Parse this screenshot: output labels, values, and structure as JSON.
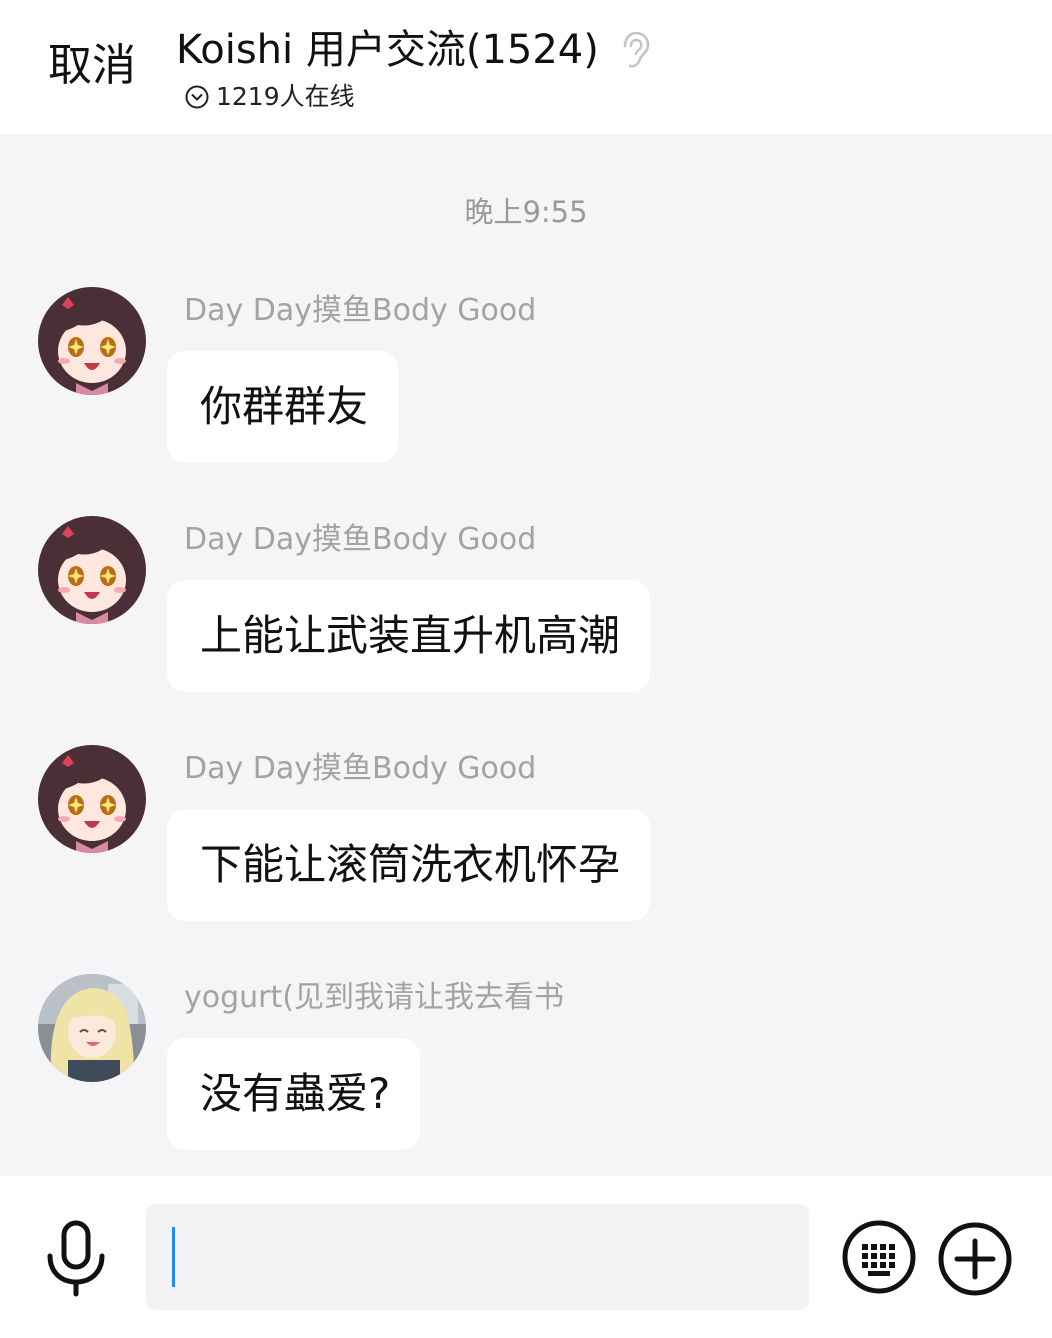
{
  "header": {
    "cancel_label": "取消",
    "title": "Koishi 用户交流(1524)",
    "online_text": "1219人在线"
  },
  "timestamp": "晚上9:55",
  "messages": [
    {
      "sender": "Day Day摸鱼Body Good",
      "text": "你群群友",
      "avatar": "anime-girl-dark-hair"
    },
    {
      "sender": "Day Day摸鱼Body Good",
      "text": "上能让武装直升机高潮",
      "avatar": "anime-girl-dark-hair"
    },
    {
      "sender": "Day Day摸鱼Body Good",
      "text": "下能让滚筒洗衣机怀孕",
      "avatar": "anime-girl-dark-hair"
    },
    {
      "sender": "yogurt(见到我请让我去看书",
      "text": "没有蟲爱?",
      "avatar": "anime-girl-blonde-hair"
    }
  ],
  "input": {
    "value": "",
    "placeholder": ""
  },
  "icons": {
    "listen": "ear-icon",
    "online": "chevron-circle-icon",
    "voice": "microphone-icon",
    "keyboard": "keyboard-icon",
    "more": "plus-circle-icon"
  },
  "colors": {
    "background": "#f5f4f6",
    "bubble": "#ffffff",
    "caret": "#1a8cff",
    "sender": "#a3a3a3"
  }
}
